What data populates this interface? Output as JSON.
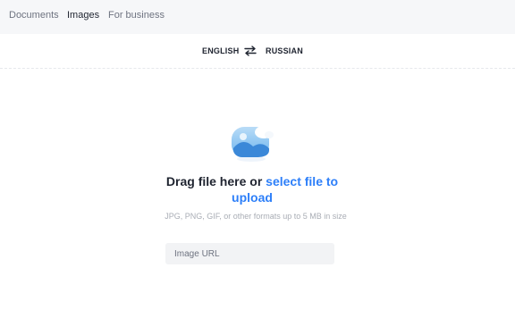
{
  "nav": {
    "tabs": [
      {
        "label": "Documents",
        "active": false
      },
      {
        "label": "Images",
        "active": true
      },
      {
        "label": "For business",
        "active": false
      }
    ]
  },
  "language": {
    "source": "ENGLISH",
    "target": "RUSSIAN",
    "swap_icon": "swap-arrows-icon"
  },
  "upload": {
    "icon": "image-upload-icon",
    "drag_text": "Drag file here or",
    "select_link": "select file to upload",
    "hint": "JPG, PNG, GIF, or other formats up to 5 MB in size",
    "url_placeholder": "Image URL"
  },
  "colors": {
    "accent": "#2d7ff9",
    "text": "#1f2430",
    "muted": "#a9adb5",
    "nav_bg": "#f6f7f9"
  }
}
